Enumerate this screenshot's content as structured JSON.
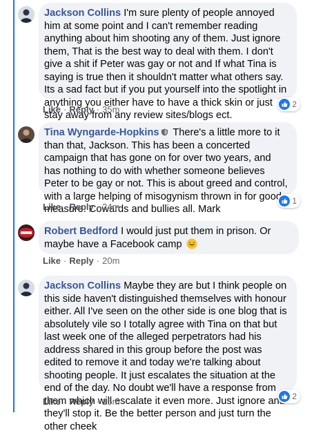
{
  "comments": [
    {
      "author": "Jackson Collins",
      "text": "I'm sure plenty of people annoyed him at some point and I can't remember reading anything about him shooting any of them. Just ignore them, That is the best way to deal with them. I don't give a shit if Peter was gay or not and If what Tina is saying is true then it shouldn't matter what others say. Its a sad fact but if you put yourself into the spotlight in anything you either have to have a thick skin or just stay away from any review sites/blogs ect.",
      "like_label": "Like",
      "reply_label": "Reply",
      "time": "35m",
      "reaction_count": "2"
    },
    {
      "author": "Tina Wyngarde-Hopkins",
      "text": "There's a little more to it than that, Jackson. This has been a concerted campaign that has gone on for over two years, and has nothing to do with whether someone believes Peter to be gay or not. This is about greed and control, with a large helping of misogynism thrown in for good measure. Cowards and bullies all. Mark",
      "like_label": "Like",
      "reply_label": "Reply",
      "time": "24m",
      "reaction_count": "1"
    },
    {
      "author": "Robert Bedford",
      "text": "I would just put them in prison. Or maybe have a Facebook camp",
      "like_label": "Like",
      "reply_label": "Reply",
      "time": "20m",
      "reaction_count": ""
    },
    {
      "author": "Jackson Collins",
      "text": "Maybe they are but I think people on this side haven't distinguished themselves with honour either. All I've seen on the other side is one blog that is absolutely vile so I totally agree with Tina on that but last week one of the alleged perpetrators had his address shared in this group before the post was edited to remove it and today we're talking about shooting people. It just escalates the situation at the end of the day. No doubt we'll have a response from them which will escalate it even more. Just ignore and they'll stop it. Be the better person and just turn the other cheek",
      "like_label": "Like",
      "reply_label": "Reply",
      "time": "15m",
      "reaction_count": "2"
    }
  ],
  "separator": "·",
  "colors": {
    "thread_line": "#1b74e4",
    "author_name": "#385898",
    "bubble_bg": "#f0f2f5",
    "like_blue": "#1877f2"
  },
  "icons": [
    "like-reaction-icon",
    "shield-icon",
    "grinning-emoji-icon"
  ]
}
